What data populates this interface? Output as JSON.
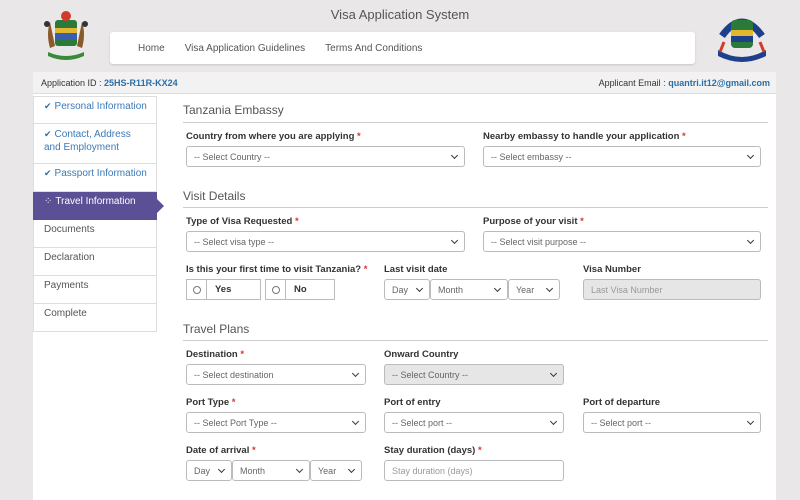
{
  "app_title": "Visa Application System",
  "nav": {
    "home": "Home",
    "guidelines": "Visa Application Guidelines",
    "terms": "Terms And Conditions"
  },
  "header": {
    "app_id_label": "Application ID :",
    "app_id": "25HS-R11R-KX24",
    "email_label": "Applicant Email :",
    "email": "quantri.it12@gmail.com"
  },
  "sidebar": {
    "items": [
      {
        "label": "Personal Information",
        "state": "done"
      },
      {
        "label": "Contact, Address and Employment",
        "state": "done"
      },
      {
        "label": "Passport Information",
        "state": "done"
      },
      {
        "label": "Travel Information",
        "state": "active"
      },
      {
        "label": "Documents",
        "state": "pending"
      },
      {
        "label": "Declaration",
        "state": "pending"
      },
      {
        "label": "Payments",
        "state": "pending"
      },
      {
        "label": "Complete",
        "state": "pending"
      }
    ]
  },
  "embassy": {
    "title": "Tanzania Embassy",
    "country_label": "Country from where you are applying",
    "country_value": "-- Select Country --",
    "nearby_label": "Nearby embassy to handle your application",
    "nearby_value": "-- Select embassy --"
  },
  "visit": {
    "title": "Visit Details",
    "type_label": "Type of Visa Requested",
    "type_value": "-- Select visa type --",
    "purpose_label": "Purpose of your visit",
    "purpose_value": "-- Select visit purpose --",
    "first_time_label": "Is this your first time to visit Tanzania?",
    "yes": "Yes",
    "no": "No",
    "last_visit_label": "Last visit date",
    "day": "Day",
    "month": "Month",
    "year": "Year",
    "visa_number_label": "Visa Number",
    "visa_number_placeholder": "Last Visa Number"
  },
  "travel": {
    "title": "Travel Plans",
    "destination_label": "Destination",
    "destination_value": "-- Select destination",
    "onward_label": "Onward Country",
    "onward_value": "-- Select Country --",
    "port_type_label": "Port Type",
    "port_type_value": "-- Select Port Type --",
    "port_entry_label": "Port of entry",
    "port_entry_value": "-- Select port --",
    "port_departure_label": "Port of departure",
    "port_departure_value": "-- Select port --",
    "arrival_label": "Date of arrival",
    "day": "Day",
    "month": "Month",
    "year": "Year",
    "stay_label": "Stay duration (days)",
    "stay_placeholder": "Stay duration (days)"
  },
  "colors": {
    "accent": "#5b4f96",
    "link": "#2a6fa8",
    "required": "#dd3333"
  }
}
